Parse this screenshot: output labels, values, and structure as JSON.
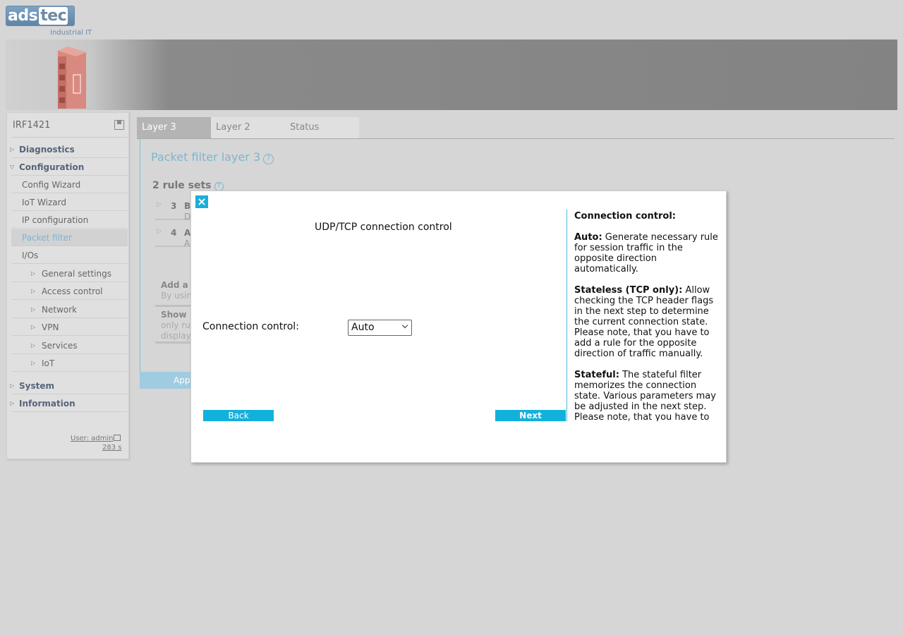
{
  "header": {
    "logo_main": "ads",
    "logo_tec": "tec",
    "tagline": "Industrial IT"
  },
  "sidebar": {
    "device_name": "IRF1421",
    "items": [
      {
        "label": "Diagnostics",
        "level": 0
      },
      {
        "label": "Configuration",
        "level": 0
      },
      {
        "label": "Config Wizard",
        "level": 1
      },
      {
        "label": "IoT Wizard",
        "level": 1
      },
      {
        "label": "IP configuration",
        "level": 1
      },
      {
        "label": "Packet filter",
        "level": 1
      },
      {
        "label": "I/Os",
        "level": 1
      },
      {
        "label": "General settings",
        "level": 2
      },
      {
        "label": "Access control",
        "level": 2
      },
      {
        "label": "Network",
        "level": 2
      },
      {
        "label": "VPN",
        "level": 2
      },
      {
        "label": "Services",
        "level": 2
      },
      {
        "label": "IoT",
        "level": 2
      },
      {
        "label": "System",
        "level": 0
      },
      {
        "label": "Information",
        "level": 0
      }
    ],
    "user": "User: admin",
    "timer": "283 s"
  },
  "tabs": [
    {
      "label": "Layer 3"
    },
    {
      "label": "Layer 2"
    },
    {
      "label": "Status"
    }
  ],
  "main": {
    "title": "Packet filter layer 3",
    "rule_sets_title": "2 rule sets",
    "rules": [
      {
        "num": "3",
        "name": "B",
        "sub": "D"
      },
      {
        "num": "4",
        "name": "A",
        "sub": "A"
      }
    ],
    "add_box": {
      "heading": "Add a",
      "desc": "By usin"
    },
    "show_box": {
      "heading": "Show",
      "desc1": "only ru",
      "desc2": "display"
    },
    "apply_label": "Appl"
  },
  "modal": {
    "close_glyph": "×",
    "title": "UDP/TCP connection control",
    "connection_label": "Connection control:",
    "connection_value": "Auto",
    "back_label": "Back",
    "next_label": "Next",
    "help": {
      "heading": "Connection control:",
      "auto_term": "Auto:",
      "auto_text": " Generate necessary rule for session traffic in the opposite direction automatically.",
      "stateless_term": "Stateless (TCP only):",
      "stateless_text": " Allow checking the TCP header flags in the next step to determine the current connection state. Please note, that you have to add a rule for the opposite direction of traffic manually.",
      "stateful_term": "Stateful:",
      "stateful_text": " The stateful filter memorizes the connection state. Various parameters may be adjusted in the next step. Please note, that you have to add a stateful rule for the opposite"
    }
  },
  "colors": {
    "accent": "#12b0dc",
    "title_blue": "#7cb5d0",
    "background": "#d6d6d6"
  }
}
